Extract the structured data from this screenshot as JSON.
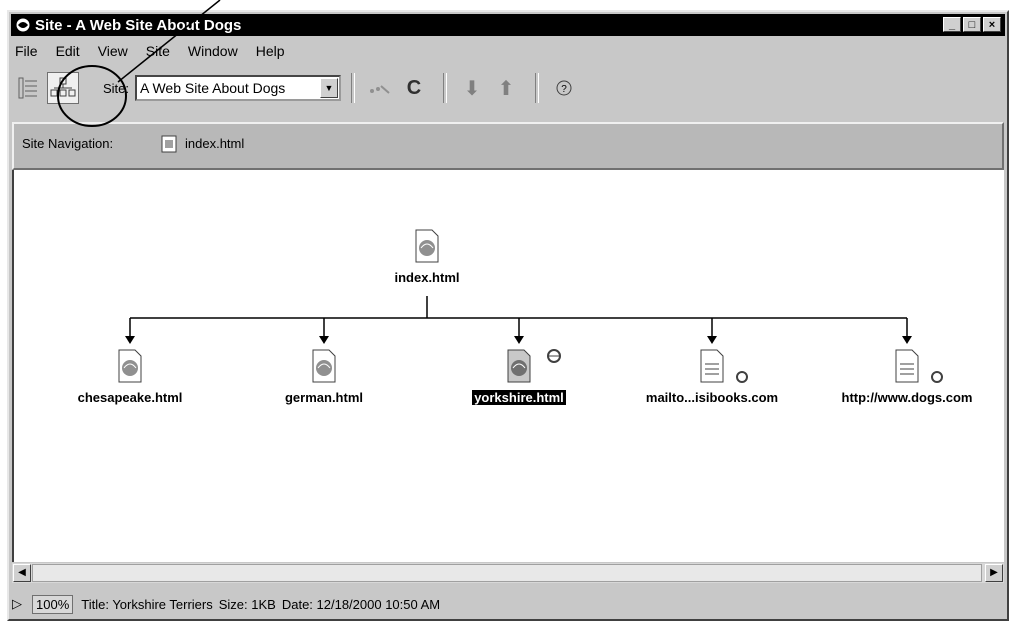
{
  "window": {
    "title": "Site - A Web Site About Dogs"
  },
  "title_buttons": {
    "minimize": "_",
    "maximize": "□",
    "close": "×"
  },
  "menu": [
    "File",
    "Edit",
    "View",
    "Site",
    "Window",
    "Help"
  ],
  "toolbar": {
    "site_label": "Site:",
    "site_value": "A Web Site About Dogs",
    "dropdown_glyph": "▼",
    "refresh_glyph": "C",
    "get_glyph": "⬇",
    "put_glyph": "⬆",
    "help_glyph": "?"
  },
  "navigation": {
    "label": "Site Navigation:",
    "file": "index.html"
  },
  "site_map": {
    "root": "index.html",
    "children": [
      {
        "label": "chesapeake.html",
        "type": "page"
      },
      {
        "label": "german.html",
        "type": "page"
      },
      {
        "label": "yorkshire.html",
        "type": "page",
        "selected": true
      },
      {
        "label": "mailto...isibooks.com",
        "type": "link"
      },
      {
        "label": "http://www.dogs.com",
        "type": "link"
      }
    ]
  },
  "scroll": {
    "left_arrow": "◀",
    "right_arrow": "▶"
  },
  "status": {
    "expand_glyph": "▷",
    "zoom": "100%",
    "title": "Title: Yorkshire Terriers",
    "size": "Size: 1KB",
    "date": "Date: 12/18/2000 10:50 AM"
  },
  "colors": {
    "titlebar": "#000000",
    "chrome": "#c8c8c8",
    "canvas": "#ffffff",
    "selection": "#000000"
  }
}
